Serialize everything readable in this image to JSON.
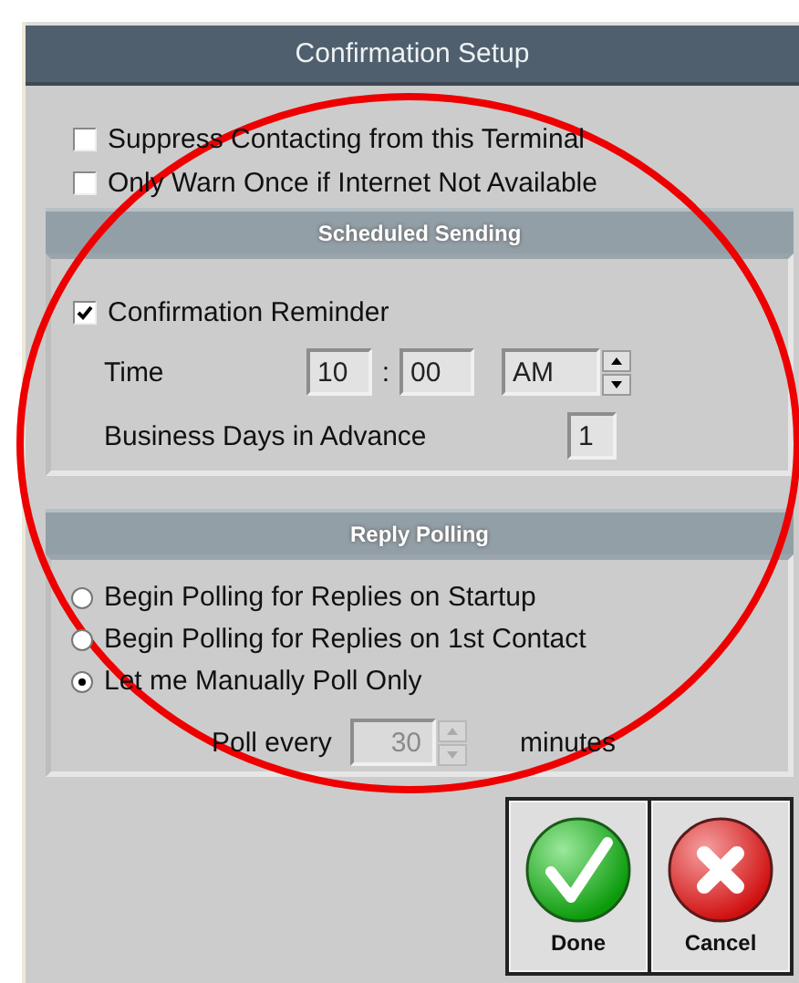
{
  "window": {
    "title": "Confirmation Setup"
  },
  "options": [
    {
      "label": "Suppress Contacting from this Terminal",
      "checked": false
    },
    {
      "label": "Only Warn Once if Internet Not Available",
      "checked": false
    }
  ],
  "scheduled_sending": {
    "title": "Scheduled Sending",
    "reminder": {
      "label": "Confirmation Reminder",
      "checked": true
    },
    "time": {
      "label": "Time",
      "hour": "10",
      "separator": ":",
      "minute": "00",
      "period": "AM"
    },
    "business_days": {
      "label": "Business Days in Advance",
      "value": "1"
    }
  },
  "reply_polling": {
    "title": "Reply Polling",
    "modes": [
      {
        "label": "Begin Polling for Replies on Startup",
        "selected": false
      },
      {
        "label": "Begin Polling for Replies on 1st Contact",
        "selected": false
      },
      {
        "label": "Let me Manually Poll Only",
        "selected": true
      }
    ],
    "poll_every": {
      "label": "Poll every",
      "value": "30",
      "disabled": true,
      "unit": "minutes"
    }
  },
  "buttons": [
    {
      "kind": "done",
      "label": "Done"
    },
    {
      "kind": "cancel",
      "label": "Cancel"
    }
  ]
}
